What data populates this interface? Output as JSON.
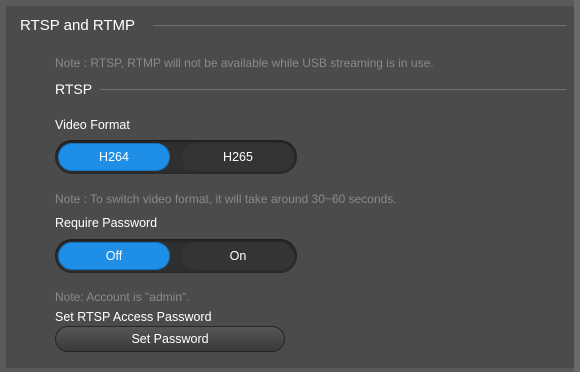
{
  "section": {
    "title": "RTSP and RTMP",
    "note": "Note : RTSP, RTMP will not be available while USB streaming is in use."
  },
  "rtsp": {
    "title": "RTSP",
    "video_format": {
      "label": "Video Format",
      "options": [
        "H264",
        "H265"
      ],
      "selected": "H264",
      "note": "Note : To switch video format, it will take around 30~60 seconds."
    },
    "require_password": {
      "label": "Require Password",
      "options": [
        "Off",
        "On"
      ],
      "selected": "Off",
      "note": "Note: Account is \"admin\"."
    },
    "access_password": {
      "label": "Set RTSP Access Password",
      "button_label": "Set Password"
    }
  },
  "colors": {
    "accent": "#1e8ee6",
    "panel_bg": "#4b4b4b",
    "note_text": "#8a8a8a"
  }
}
